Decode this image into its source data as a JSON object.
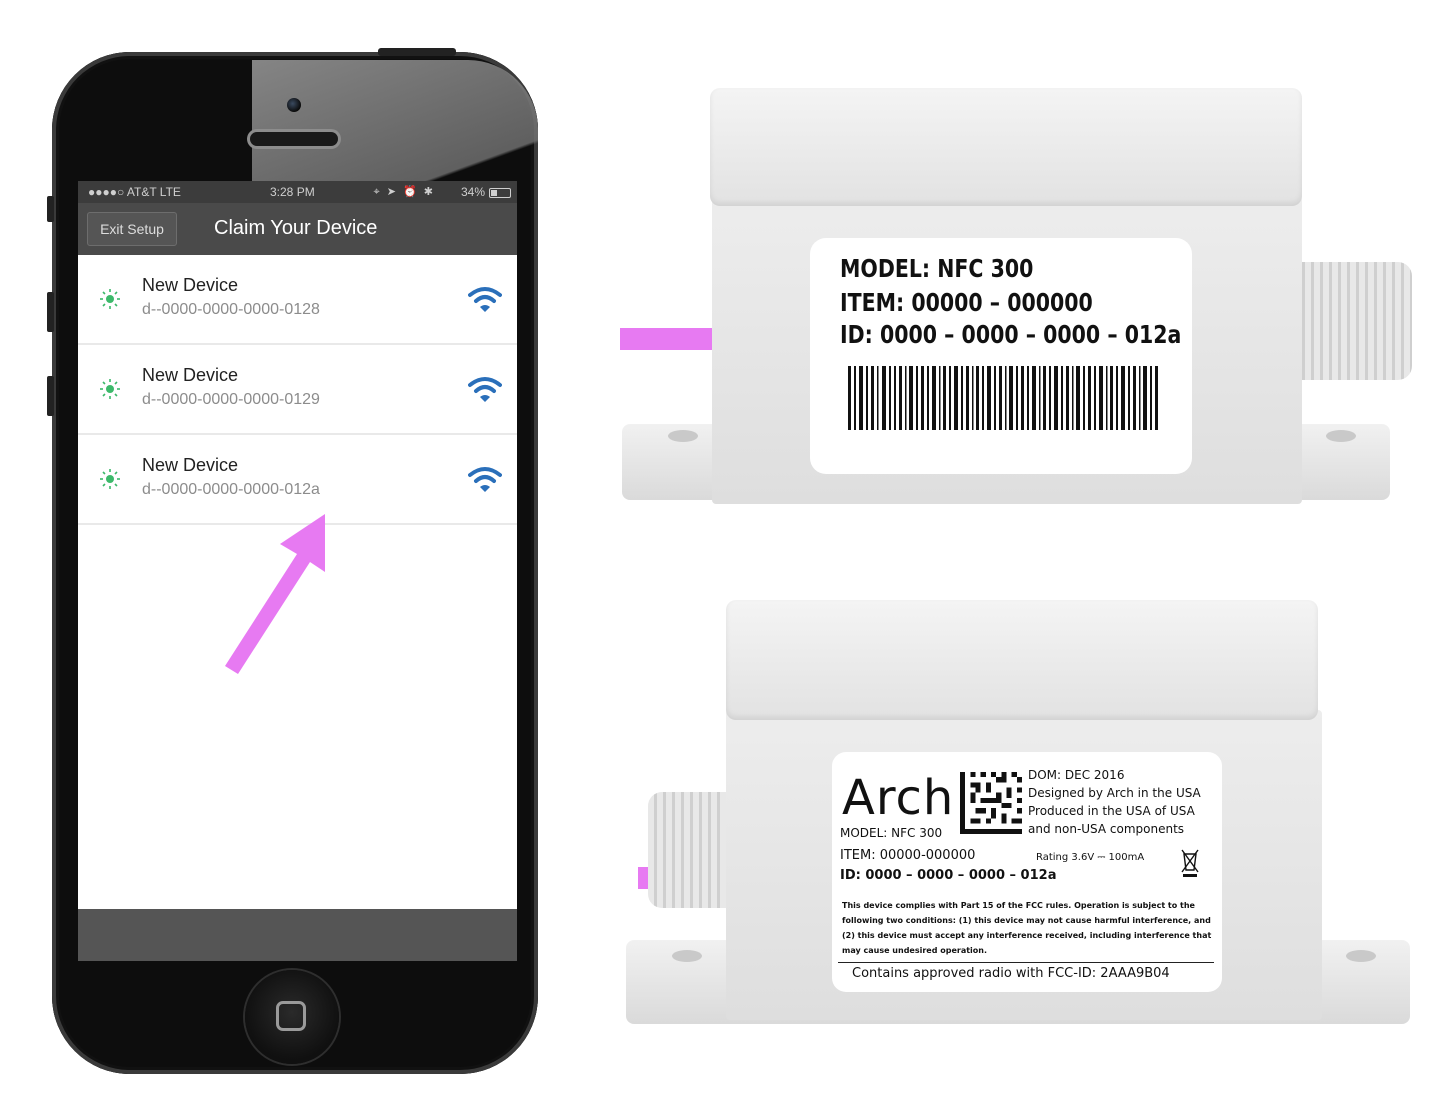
{
  "phone": {
    "status_bar": {
      "carrier": "●●●●○ AT&T  LTE",
      "time": "3:28 PM",
      "indicators": "⌖ ➤ ⏰ ✱",
      "battery": "34%"
    },
    "nav": {
      "exit_button": "Exit Setup",
      "title": "Claim Your Device"
    },
    "devices": [
      {
        "name": "New Device",
        "id": "d--0000-0000-0000-0128",
        "status_icon": "sun-icon",
        "signal_icon": "wifi-icon"
      },
      {
        "name": "New Device",
        "id": "d--0000-0000-0000-0129",
        "status_icon": "sun-icon",
        "signal_icon": "wifi-icon"
      },
      {
        "name": "New Device",
        "id": "d--0000-0000-0000-012a",
        "status_icon": "sun-icon",
        "signal_icon": "wifi-icon"
      }
    ]
  },
  "colors": {
    "arrow": "#e77af2",
    "status_icon": "#3cb96a",
    "wifi_icon": "#2a6fba"
  },
  "label_top": {
    "model": "MODEL: NFC 300",
    "item": "ITEM: 00000 – 000000",
    "id": "ID:  0000 – 0000 – 0000 – 012a"
  },
  "label_bottom": {
    "brand": "Arch",
    "dom": "DOM: DEC 2016",
    "designed": "Designed by Arch in the USA",
    "produced": "Produced in the USA of USA",
    "components": "and non-USA components",
    "model": "MODEL: NFC 300",
    "item": "ITEM: 00000-000000",
    "rating": "Rating 3.6V ⎓ 100mA",
    "id": "ID: 0000 – 0000 – 0000 – 012a",
    "fcc_notice": "This device complies with Part 15 of the FCC rules. Operation is subject to the following two conditions: (1) this device may not cause harmful interference, and (2) this device must accept any interference received, including interference that may cause undesired operation.",
    "radio": "Contains approved radio with FCC-ID: 2AAA9B04"
  }
}
